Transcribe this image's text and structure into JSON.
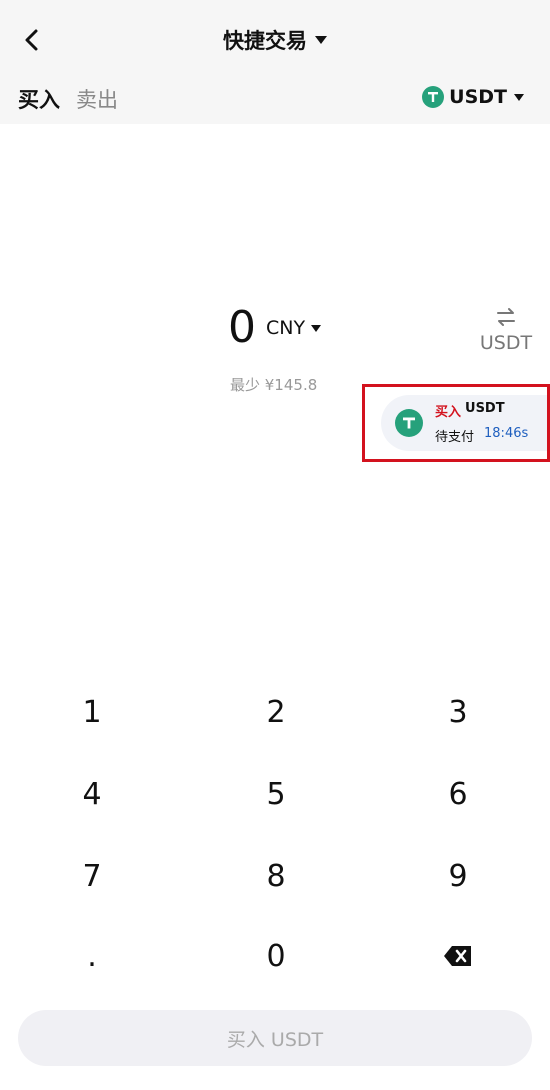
{
  "header": {
    "title": "快捷交易",
    "tabs": [
      {
        "label": "买入",
        "active": true
      },
      {
        "label": "卖出",
        "active": false
      }
    ],
    "coin": {
      "label": "USDT",
      "icon": "tether-icon",
      "color": "#26a17b"
    }
  },
  "amount": {
    "value": "0",
    "currency": "CNY",
    "min_hint": "最少 ¥145.8"
  },
  "swap": {
    "label": "USDT",
    "icon": "swap-icon"
  },
  "toast": {
    "buy": "买入",
    "coin": "USDT",
    "status": "待支付",
    "timer": "18:46s",
    "highlight_color": "#d3121e"
  },
  "keypad": {
    "keys": [
      "1",
      "2",
      "3",
      "4",
      "5",
      "6",
      "7",
      "8",
      "9",
      ".",
      "0"
    ],
    "delete_icon": "backspace-icon"
  },
  "cta": {
    "label": "买入 USDT"
  }
}
